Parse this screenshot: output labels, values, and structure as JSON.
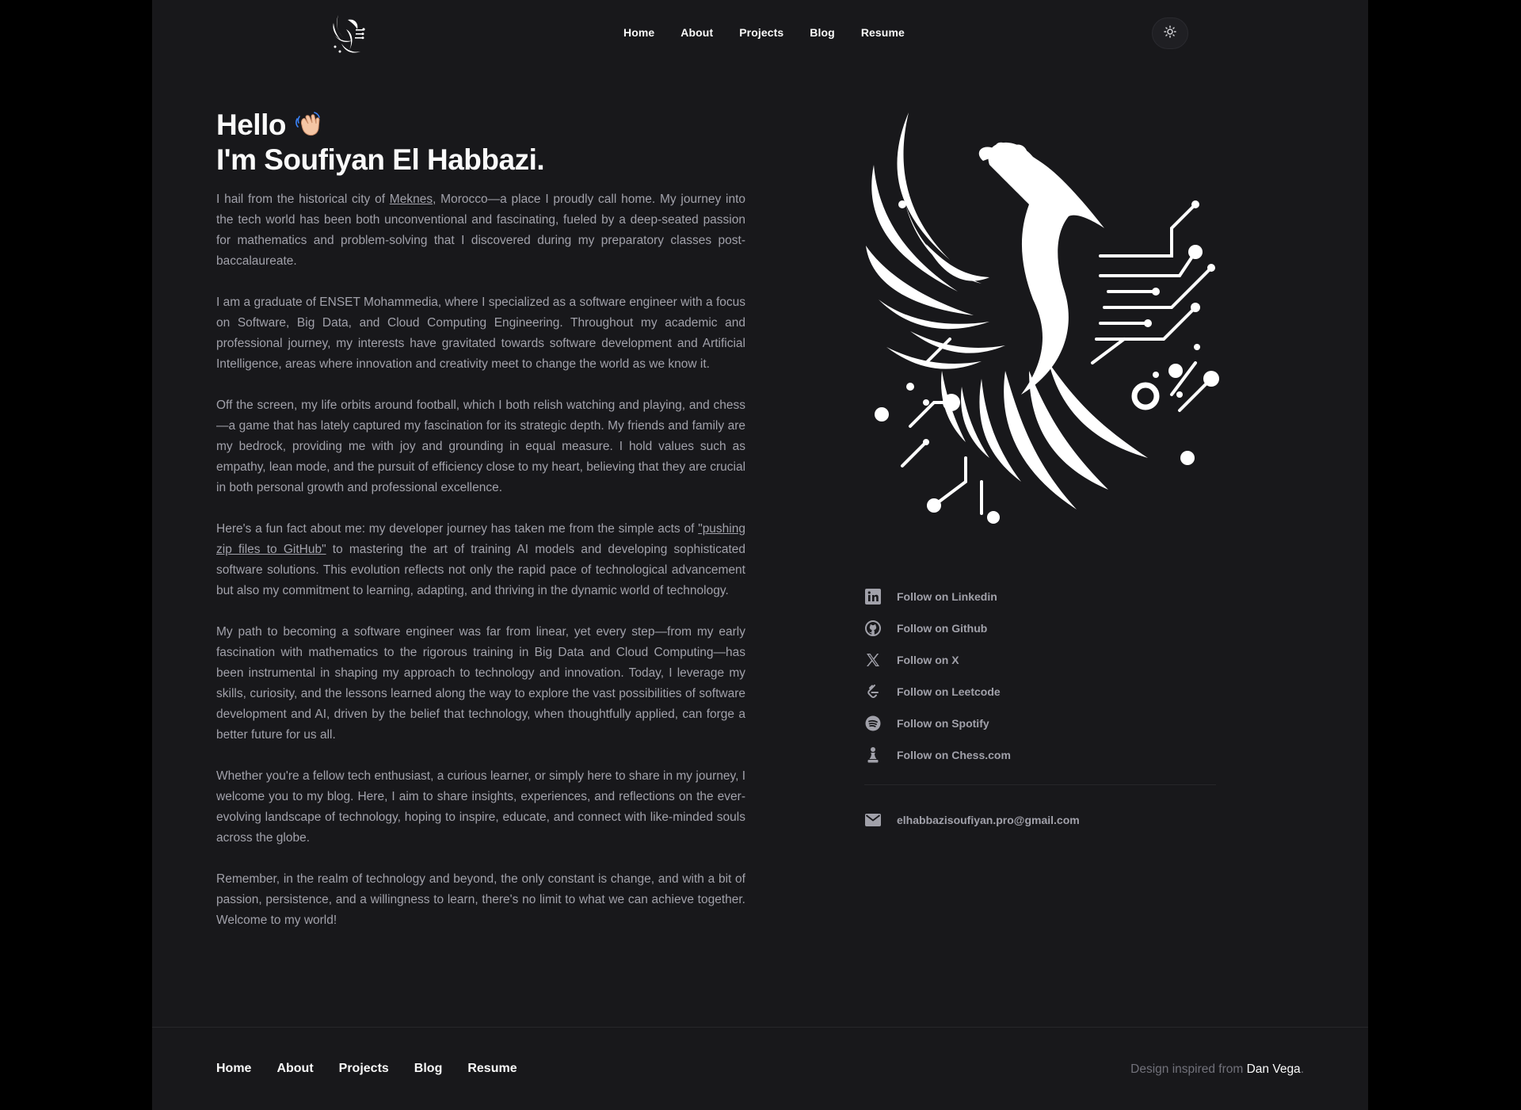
{
  "nav": {
    "items": [
      "Home",
      "About",
      "Projects",
      "Blog",
      "Resume"
    ]
  },
  "theme_toggle": {
    "icon": "sun-icon"
  },
  "hero": {
    "greeting": "Hello",
    "wave_emoji": "👋",
    "name_line": "I'm Soufiyan El Habbazi.",
    "paragraphs": {
      "p1_before": "I hail from the historical city of ",
      "p1_link": "Meknes",
      "p1_after": ", Morocco—a place I proudly call home. My journey into the tech world has been both unconventional and fascinating, fueled by a deep-seated passion for mathematics and problem-solving that I discovered during my preparatory classes post-baccalaureate.",
      "p2": "I am a graduate of ENSET Mohammedia, where I specialized as a software engineer with a focus on Software, Big Data, and Cloud Computing Engineering. Throughout my academic and professional journey, my interests have gravitated towards software development and Artificial Intelligence, areas where innovation and creativity meet to change the world as we know it.",
      "p3": "Off the screen, my life orbits around football, which I both relish watching and playing, and chess—a game that has lately captured my fascination for its strategic depth. My friends and family are my bedrock, providing me with joy and grounding in equal measure. I hold values such as empathy, lean mode, and the pursuit of efficiency close to my heart, believing that they are crucial in both personal growth and professional excellence.",
      "p4_before": "Here's a fun fact about me: my developer journey has taken me from the simple acts of ",
      "p4_link": "\"pushing zip files to GitHub\"",
      "p4_after": " to mastering the art of training AI models and developing sophisticated software solutions. This evolution reflects not only the rapid pace of technological advancement but also my commitment to learning, adapting, and thriving in the dynamic world of technology.",
      "p5": "My path to becoming a software engineer was far from linear, yet every step—from my early fascination with mathematics to the rigorous training in Big Data and Cloud Computing—has been instrumental in shaping my approach to technology and innovation. Today, I leverage my skills, curiosity, and the lessons learned along the way to explore the vast possibilities of software development and AI, driven by the belief that technology, when thoughtfully applied, can forge a better future for us all.",
      "p6": "Whether you're a fellow tech enthusiast, a curious learner, or simply here to share in my journey, I welcome you to my blog. Here, I aim to share insights, experiences, and reflections on the ever-evolving landscape of technology, hoping to inspire, educate, and connect with like-minded souls across the globe.",
      "p7": "Remember, in the realm of technology and beyond, the only constant is change, and with a bit of passion, persistence, and a willingness to learn, there's no limit to what we can achieve together. Welcome to my world!"
    }
  },
  "socials": [
    {
      "label": "Follow on Linkedin",
      "icon": "linkedin-icon"
    },
    {
      "label": "Follow on Github",
      "icon": "github-icon"
    },
    {
      "label": "Follow on X",
      "icon": "x-icon"
    },
    {
      "label": "Follow on Leetcode",
      "icon": "leetcode-icon"
    },
    {
      "label": "Follow on Spotify",
      "icon": "spotify-icon"
    },
    {
      "label": "Follow on Chess.com",
      "icon": "chess-pawn-icon"
    }
  ],
  "email": {
    "label": "elhabbazisoufiyan.pro@gmail.com",
    "icon": "mail-icon"
  },
  "footer": {
    "nav": [
      "Home",
      "About",
      "Projects",
      "Blog",
      "Resume"
    ],
    "credit_prefix": "Design inspired from ",
    "credit_author": "Dan Vega",
    "credit_suffix": "."
  },
  "colors": {
    "page_bg": "#18181b",
    "outer_bg": "#000000",
    "heading": "#fafafa",
    "body_text": "#a1a1aa",
    "muted": "#71717a"
  }
}
